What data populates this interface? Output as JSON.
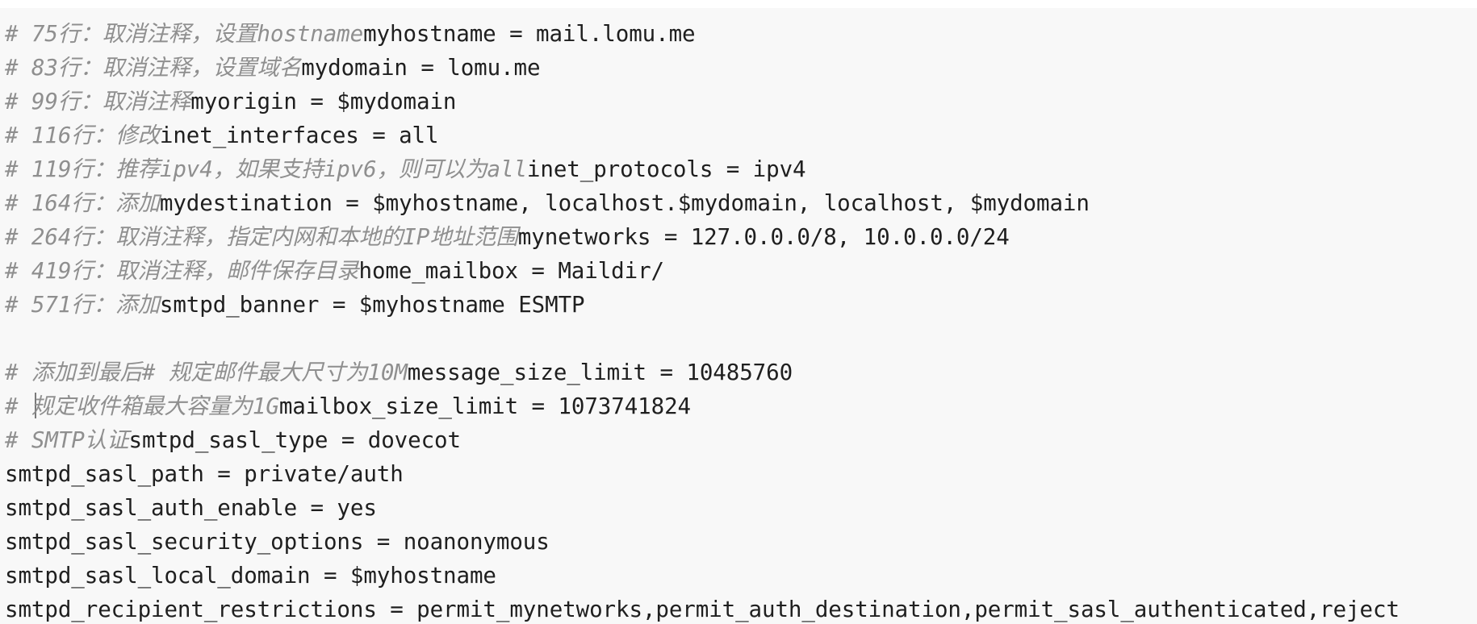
{
  "lines": [
    {
      "comment": "# 75行：取消注释，设置hostname",
      "code": "myhostname = mail.lomu.me"
    },
    {
      "comment": "# 83行：取消注释，设置域名",
      "code": "mydomain = lomu.me"
    },
    {
      "comment": "# 99行：取消注释",
      "code": "myorigin = $mydomain"
    },
    {
      "comment": "# 116行：修改",
      "code": "inet_interfaces = all"
    },
    {
      "comment": "# 119行：推荐ipv4，如果支持ipv6，则可以为all",
      "code": "inet_protocols = ipv4"
    },
    {
      "comment": "# 164行：添加",
      "code": "mydestination = $myhostname, localhost.$mydomain, localhost, $mydomain"
    },
    {
      "comment": "# 264行：取消注释，指定内网和本地的IP地址范围",
      "code": "mynetworks = 127.0.0.0/8, 10.0.0.0/24"
    },
    {
      "comment": "# 419行：取消注释，邮件保存目录",
      "code": "home_mailbox = Maildir/"
    },
    {
      "comment": "# 571行：添加",
      "code": "smtpd_banner = $myhostname ESMTP"
    },
    {
      "comment": "",
      "code": ""
    },
    {
      "comment": "# 添加到最后# 规定邮件最大尺寸为10M",
      "code": "message_size_limit = 10485760"
    },
    {
      "comment_prefix": "# ",
      "comment": "规定收件箱最大容量为1G",
      "code": "mailbox_size_limit = 1073741824"
    },
    {
      "comment": "# SMTP认证",
      "code": "smtpd_sasl_type = dovecot"
    },
    {
      "comment": "",
      "code": "smtpd_sasl_path = private/auth"
    },
    {
      "comment": "",
      "code": "smtpd_sasl_auth_enable = yes"
    },
    {
      "comment": "",
      "code": "smtpd_sasl_security_options = noanonymous"
    },
    {
      "comment": "",
      "code": "smtpd_sasl_local_domain = $myhostname"
    },
    {
      "comment": "",
      "code": "smtpd_recipient_restrictions = permit_mynetworks,permit_auth_destination,permit_sasl_authenticated,reject"
    }
  ],
  "colors": {
    "background": "#f8f8f8",
    "comment": "#8f8f8f",
    "code": "#1f1f1f"
  }
}
